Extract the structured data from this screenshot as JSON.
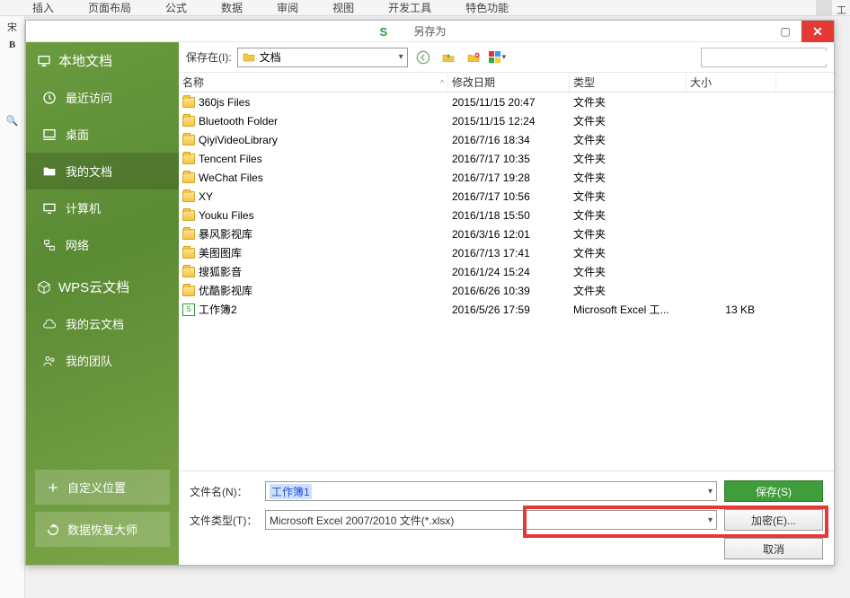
{
  "ribbon": {
    "tabs": [
      "插入",
      "页面布局",
      "公式",
      "数据",
      "审阅",
      "视图",
      "开发工具",
      "特色功能"
    ],
    "truncated_right": "工"
  },
  "side_small": {
    "line1": "宋",
    "bold": "B",
    "glass": "🔍"
  },
  "dialog": {
    "title": "另存为",
    "sidebar": {
      "header": "本地文档",
      "items": [
        {
          "icon": "recent",
          "label": "最近访问"
        },
        {
          "icon": "desktop",
          "label": "桌面"
        },
        {
          "icon": "folder",
          "label": "我的文档",
          "active": true
        },
        {
          "icon": "computer",
          "label": "计算机"
        },
        {
          "icon": "network",
          "label": "网络"
        }
      ],
      "cloud_header": "WPS云文档",
      "cloud_items": [
        {
          "icon": "cloud-doc",
          "label": "我的云文档"
        },
        {
          "icon": "team",
          "label": "我的团队"
        }
      ],
      "bottom": [
        {
          "icon": "plus",
          "label": "自定义位置"
        },
        {
          "icon": "restore",
          "label": "数据恢复大师"
        }
      ]
    },
    "toolbar": {
      "save_in_label": "保存在(I):",
      "location": "文档",
      "search_placeholder": ""
    },
    "columns": {
      "name": "名称",
      "date": "修改日期",
      "type": "类型",
      "size": "大小"
    },
    "files": [
      {
        "icon": "folder",
        "name": "360js Files",
        "date": "2015/11/15 20:47",
        "type": "文件夹",
        "size": ""
      },
      {
        "icon": "folder",
        "name": "Bluetooth Folder",
        "date": "2015/11/15 12:24",
        "type": "文件夹",
        "size": ""
      },
      {
        "icon": "folder",
        "name": "QiyiVideoLibrary",
        "date": "2016/7/16 18:34",
        "type": "文件夹",
        "size": ""
      },
      {
        "icon": "folder",
        "name": "Tencent Files",
        "date": "2016/7/17 10:35",
        "type": "文件夹",
        "size": ""
      },
      {
        "icon": "folder",
        "name": "WeChat Files",
        "date": "2016/7/17 19:28",
        "type": "文件夹",
        "size": ""
      },
      {
        "icon": "folder",
        "name": "XY",
        "date": "2016/7/17 10:56",
        "type": "文件夹",
        "size": ""
      },
      {
        "icon": "folder",
        "name": "Youku Files",
        "date": "2016/1/18 15:50",
        "type": "文件夹",
        "size": ""
      },
      {
        "icon": "folder",
        "name": "暴风影视库",
        "date": "2016/3/16 12:01",
        "type": "文件夹",
        "size": ""
      },
      {
        "icon": "folder",
        "name": "美图图库",
        "date": "2016/7/13 17:41",
        "type": "文件夹",
        "size": ""
      },
      {
        "icon": "folder",
        "name": "搜狐影音",
        "date": "2016/1/24 15:24",
        "type": "文件夹",
        "size": ""
      },
      {
        "icon": "folder",
        "name": "优酷影视库",
        "date": "2016/6/26 10:39",
        "type": "文件夹",
        "size": ""
      },
      {
        "icon": "xls",
        "name": "工作簿2",
        "date": "2016/5/26 17:59",
        "type": "Microsoft Excel 工...",
        "size": "13 KB"
      }
    ],
    "form": {
      "filename_label": "文件名(N)：",
      "filename_value": "工作簿1",
      "filetype_label": "文件类型(T)：",
      "filetype_value": "Microsoft Excel 2007/2010 文件(*.xlsx)",
      "save_btn": "保存(S)",
      "encrypt_btn": "加密(E)...",
      "cancel_btn": "取消"
    }
  }
}
